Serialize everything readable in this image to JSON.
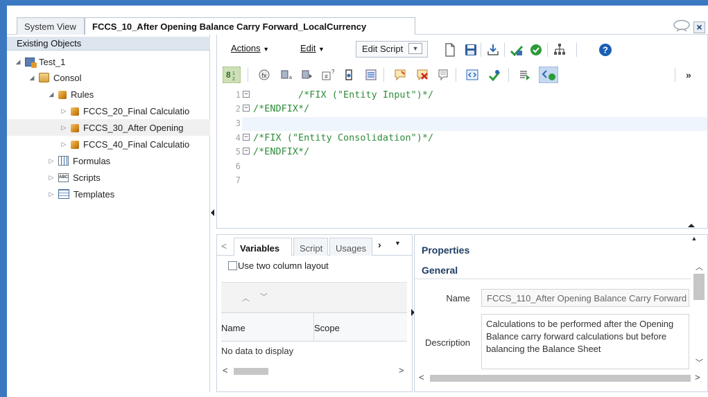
{
  "tabs": {
    "system_view": "System View",
    "active": "FCCS_10_After Opening Balance Carry Forward_LocalCurrency"
  },
  "tree": {
    "header": "Existing Objects",
    "items": [
      {
        "label": "Test_1",
        "icon": "application-icon"
      },
      {
        "label": "Consol",
        "icon": "consol-cube-icon"
      },
      {
        "label": "Rules",
        "icon": "rules-cube-icon"
      },
      {
        "label": "FCCS_20_Final Calculatio",
        "icon": "rule-icon"
      },
      {
        "label": "FCCS_30_After Opening",
        "icon": "rule-icon"
      },
      {
        "label": "FCCS_40_Final Calculatio",
        "icon": "rule-icon"
      },
      {
        "label": "Formulas",
        "icon": "formulas-icon"
      },
      {
        "label": "Scripts",
        "icon": "scripts-icon"
      },
      {
        "label": "Templates",
        "icon": "templates-icon"
      }
    ]
  },
  "toolbar": {
    "actions_label": "Actions",
    "edit_label": "Edit",
    "edit_script_label": "Edit Script",
    "icons": [
      "new-icon",
      "save-icon",
      "download-icon",
      "validate-deploy-icon",
      "validate-icon",
      "network-icon",
      "help-icon"
    ],
    "help_color": "#1a5fb4"
  },
  "editor": {
    "line_numbers": [
      "1",
      "2",
      "3",
      "4",
      "5",
      "6",
      "7"
    ],
    "lines": [
      "        /*FIX (\"Entity Input\")*/",
      "/*ENDFIX*/",
      "",
      "/*FIX (\"Entity Consolidation\")*/",
      "/*ENDFIX*/",
      "",
      ""
    ],
    "code_color": "#2e8b3a"
  },
  "bottom_tabs": {
    "variables": "Variables",
    "script": "Script",
    "usages": "Usages"
  },
  "variables": {
    "two_column_label": "Use two column layout",
    "col_name": "Name",
    "col_scope": "Scope",
    "empty": "No data to display"
  },
  "properties": {
    "title": "Properties",
    "section": "General",
    "name_label": "Name",
    "name_value": "FCCS_110_After Opening Balance Carry Forward",
    "description_label": "Description",
    "description_value": "Calculations to be performed after the Opening Balance carry forward calculations but before balancing the Balance Sheet"
  }
}
